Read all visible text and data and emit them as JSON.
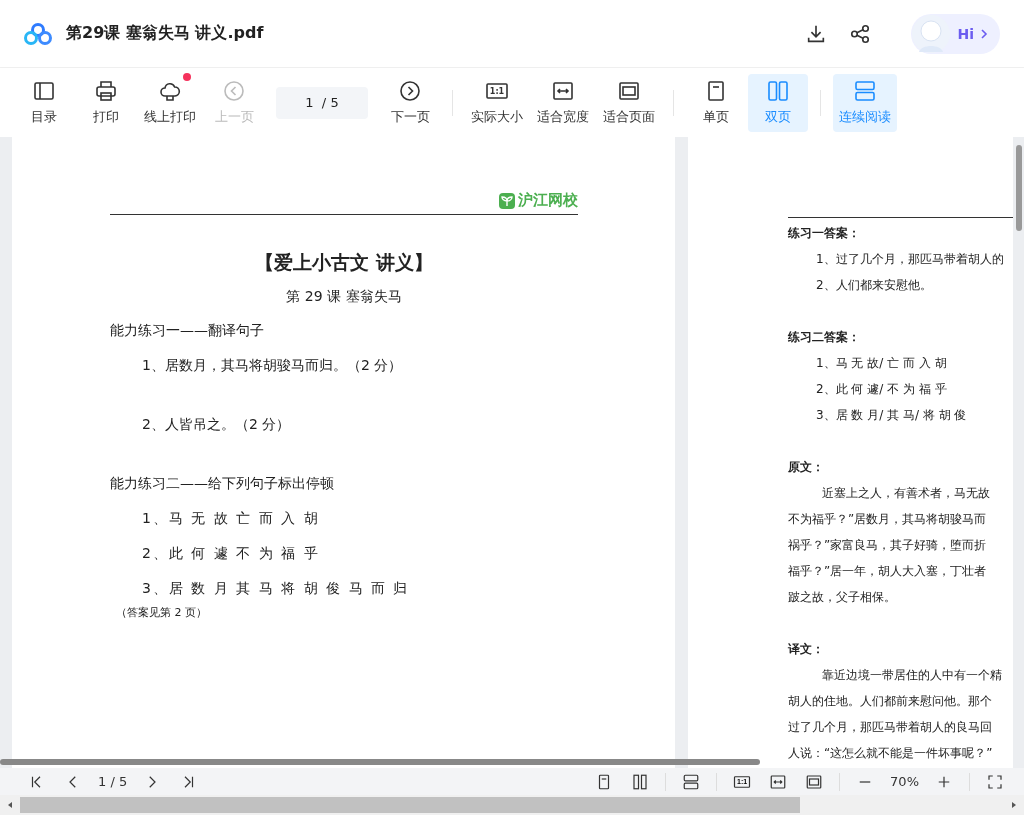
{
  "file": {
    "title": "第29课 塞翁失马 讲义.pdf"
  },
  "header_actions": [
    {
      "kind": "download"
    },
    {
      "kind": "share"
    }
  ],
  "assistant": {
    "label": "Hi"
  },
  "toolbar": [
    {
      "kind": "toc",
      "label": "目录",
      "disabled": false,
      "selected": false,
      "dot": false
    },
    {
      "kind": "print",
      "label": "打印",
      "disabled": false,
      "selected": false,
      "dot": false
    },
    {
      "kind": "cloud",
      "label": "线上打印",
      "disabled": false,
      "selected": false,
      "dot": true
    },
    {
      "kind": "prev",
      "label": "上一页",
      "disabled": true,
      "selected": false,
      "dot": false
    },
    {
      "kind": "page",
      "value": "1  / 5"
    },
    {
      "kind": "next",
      "label": "下一页",
      "disabled": false,
      "selected": false,
      "dot": false
    },
    {
      "kind": "sep"
    },
    {
      "kind": "actual",
      "label": "实际大小",
      "icon_text": "1:1",
      "disabled": false,
      "selected": false,
      "dot": false
    },
    {
      "kind": "fitwidth",
      "label": "适合宽度",
      "disabled": false,
      "selected": false,
      "dot": false
    },
    {
      "kind": "fitpage",
      "label": "适合页面",
      "disabled": false,
      "selected": false,
      "dot": false
    },
    {
      "kind": "sep"
    },
    {
      "kind": "single",
      "label": "单页",
      "disabled": false,
      "selected": false,
      "dot": false
    },
    {
      "kind": "double",
      "label": "双页",
      "disabled": false,
      "selected": true,
      "dot": false
    },
    {
      "kind": "sep"
    },
    {
      "kind": "continuous",
      "label": "连续阅读",
      "disabled": false,
      "selected": true,
      "dot": false
    }
  ],
  "left_page": {
    "logo": "沪江网校",
    "title": "【爱上小古文 讲义】",
    "subtitle": "第 29 课  塞翁失马",
    "blocks": [
      {
        "kind": "heading",
        "text": "能力练习一——翻译句子"
      },
      {
        "kind": "question",
        "text": "1、居数月，其马将胡骏马而归。（2 分）"
      },
      {
        "kind": "question",
        "text": "2、人皆吊之。（2 分）"
      },
      {
        "kind": "heading",
        "text": "能力练习二——给下列句子标出停顿"
      },
      {
        "kind": "spaced",
        "text": "1、马 无 故 亡 而 入 胡"
      },
      {
        "kind": "spaced",
        "text": "2、此 何 遽 不 为 福 乎"
      },
      {
        "kind": "spaced",
        "text": "3、居 数 月 其 马 将 胡 俊 马 而 归"
      },
      {
        "kind": "note",
        "text": "（答案见第 2 页）"
      }
    ]
  },
  "right_page": {
    "blocks": [
      {
        "kind": "heading",
        "text": "练习一答案："
      },
      {
        "kind": "item",
        "text": "1、过了几个月，那匹马带着胡人的"
      },
      {
        "kind": "item",
        "text": "2、人们都来安慰他。"
      },
      {
        "kind": "heading",
        "text": "练习二答案："
      },
      {
        "kind": "item",
        "text": "1、马 无 故/ 亡 而 入 胡"
      },
      {
        "kind": "item",
        "text": "2、此 何 遽/ 不 为 福 乎"
      },
      {
        "kind": "item",
        "text": "3、居 数 月/ 其 马/ 将 胡 俊"
      },
      {
        "kind": "heading",
        "text": "原文："
      },
      {
        "kind": "para",
        "text": "近塞上之人，有善术者，马无故"
      },
      {
        "kind": "line",
        "text": "不为福乎？”居数月，其马将胡骏马而"
      },
      {
        "kind": "line",
        "text": "祸乎？”家富良马，其子好骑，堕而折"
      },
      {
        "kind": "line",
        "text": "福乎？”居一年，胡人大入塞，丁壮者"
      },
      {
        "kind": "line",
        "text": "跛之故，父子相保。"
      },
      {
        "kind": "heading",
        "text": "译文："
      },
      {
        "kind": "para",
        "text": "靠近边境一带居住的人中有一个精"
      },
      {
        "kind": "line",
        "text": "胡人的住地。人们都前来慰问他。那个"
      },
      {
        "kind": "line",
        "text": "过了几个月，那匹马带着胡人的良马回"
      },
      {
        "kind": "line",
        "text": "人说：“这怎么就不能是一件坏事呢？”"
      }
    ]
  },
  "bottom_bar": [
    {
      "kind": "first"
    },
    {
      "kind": "prev"
    },
    {
      "kind": "page",
      "value": "1 / 5"
    },
    {
      "kind": "next"
    },
    {
      "kind": "last"
    },
    {
      "kind": "gap"
    },
    {
      "kind": "single"
    },
    {
      "kind": "double"
    },
    {
      "kind": "sep"
    },
    {
      "kind": "continuous"
    },
    {
      "kind": "sep"
    },
    {
      "kind": "actual",
      "icon_text": "1:1"
    },
    {
      "kind": "fitwidth"
    },
    {
      "kind": "fitpage"
    },
    {
      "kind": "sep"
    },
    {
      "kind": "minus"
    },
    {
      "kind": "zoom",
      "value": "70%"
    },
    {
      "kind": "plus"
    },
    {
      "kind": "sep"
    },
    {
      "kind": "fullscreen"
    }
  ]
}
